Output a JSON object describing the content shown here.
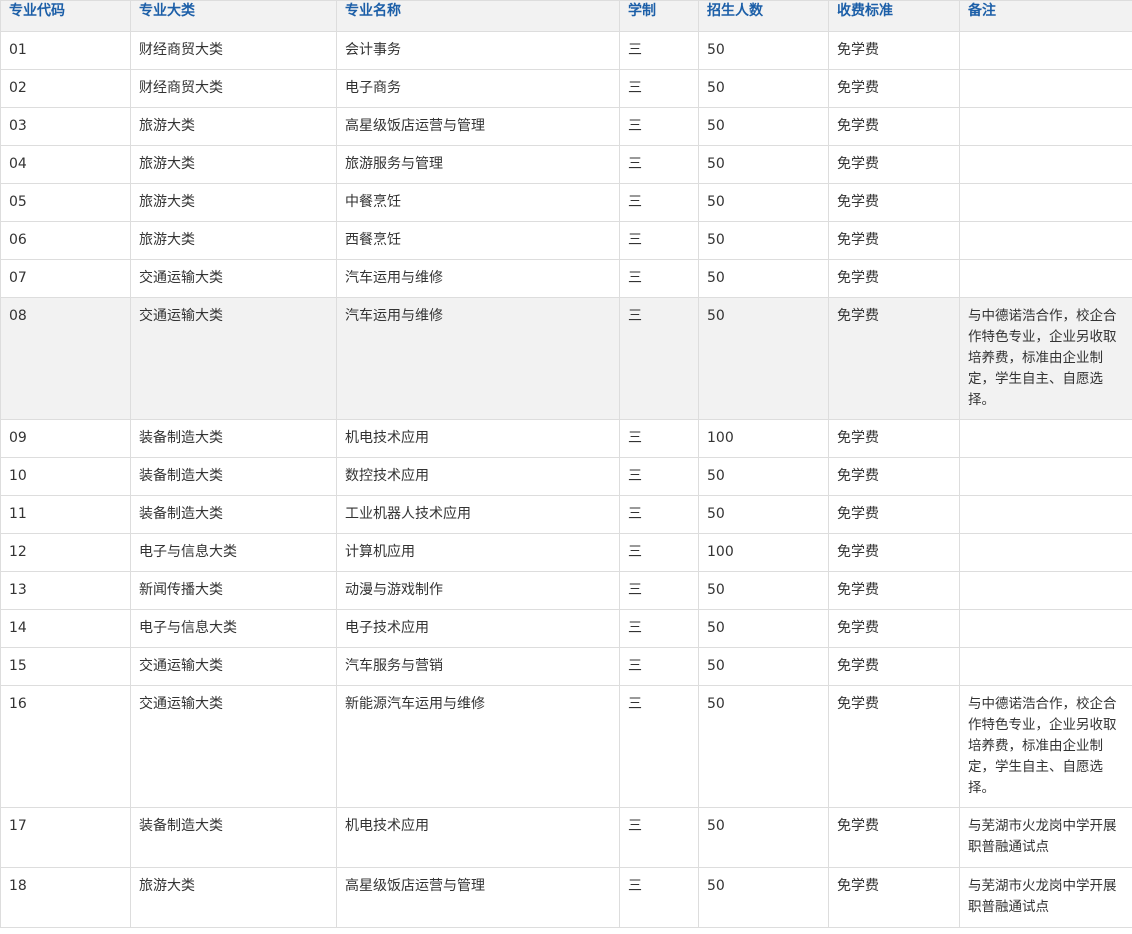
{
  "table": {
    "headers": [
      "专业代码",
      "专业大类",
      "专业名称",
      "学制",
      "招生人数",
      "收费标准",
      "备注"
    ],
    "rows": [
      {
        "code": "01",
        "category": "财经商贸大类",
        "name": "会计事务",
        "years": "三",
        "enroll": "50",
        "fee": "免学费",
        "note": ""
      },
      {
        "code": "02",
        "category": "财经商贸大类",
        "name": "电子商务",
        "years": "三",
        "enroll": "50",
        "fee": "免学费",
        "note": ""
      },
      {
        "code": "03",
        "category": "旅游大类",
        "name": "高星级饭店运营与管理",
        "years": "三",
        "enroll": "50",
        "fee": "免学费",
        "note": ""
      },
      {
        "code": "04",
        "category": "旅游大类",
        "name": "旅游服务与管理",
        "years": "三",
        "enroll": "50",
        "fee": "免学费",
        "note": ""
      },
      {
        "code": "05",
        "category": "旅游大类",
        "name": "中餐烹饪",
        "years": "三",
        "enroll": "50",
        "fee": "免学费",
        "note": ""
      },
      {
        "code": "06",
        "category": "旅游大类",
        "name": "西餐烹饪",
        "years": "三",
        "enroll": "50",
        "fee": "免学费",
        "note": ""
      },
      {
        "code": "07",
        "category": "交通运输大类",
        "name": "汽车运用与维修",
        "years": "三",
        "enroll": "50",
        "fee": "免学费",
        "note": ""
      },
      {
        "code": "08",
        "category": "交通运输大类",
        "name": "汽车运用与维修",
        "years": "三",
        "enroll": "50",
        "fee": "免学费",
        "note": "与中德诺浩合作，校企合作特色专业，企业另收取培养费，标准由企业制定，学生自主、自愿选择。"
      },
      {
        "code": "09",
        "category": "装备制造大类",
        "name": "机电技术应用",
        "years": "三",
        "enroll": "100",
        "fee": "免学费",
        "note": ""
      },
      {
        "code": "10",
        "category": "装备制造大类",
        "name": "数控技术应用",
        "years": "三",
        "enroll": "50",
        "fee": "免学费",
        "note": ""
      },
      {
        "code": "11",
        "category": "装备制造大类",
        "name": "工业机器人技术应用",
        "years": "三",
        "enroll": "50",
        "fee": "免学费",
        "note": ""
      },
      {
        "code": "12",
        "category": "电子与信息大类",
        "name": "计算机应用",
        "years": "三",
        "enroll": "100",
        "fee": "免学费",
        "note": ""
      },
      {
        "code": "13",
        "category": "新闻传播大类",
        "name": "动漫与游戏制作",
        "years": "三",
        "enroll": "50",
        "fee": "免学费",
        "note": ""
      },
      {
        "code": "14",
        "category": "电子与信息大类",
        "name": "电子技术应用",
        "years": "三",
        "enroll": "50",
        "fee": "免学费",
        "note": ""
      },
      {
        "code": "15",
        "category": "交通运输大类",
        "name": "汽车服务与营销",
        "years": "三",
        "enroll": "50",
        "fee": "免学费",
        "note": ""
      },
      {
        "code": "16",
        "category": "交通运输大类",
        "name": "新能源汽车运用与维修",
        "years": "三",
        "enroll": "50",
        "fee": "免学费",
        "note": "与中德诺浩合作，校企合作特色专业，企业另收取培养费，标准由企业制定，学生自主、自愿选择。"
      },
      {
        "code": "17",
        "category": "装备制造大类",
        "name": "机电技术应用",
        "years": "三",
        "enroll": "50",
        "fee": "免学费",
        "note": "与芜湖市火龙岗中学开展职普融通试点"
      },
      {
        "code": "18",
        "category": "旅游大类",
        "name": "高星级饭店运营与管理",
        "years": "三",
        "enroll": "50",
        "fee": "免学费",
        "note": "与芜湖市火龙岗中学开展职普融通试点"
      }
    ]
  },
  "colors": {
    "header_text": "#1c5fa8",
    "header_bg": "#f2f2f2",
    "border": "#dddddd",
    "body_text": "#333333"
  }
}
